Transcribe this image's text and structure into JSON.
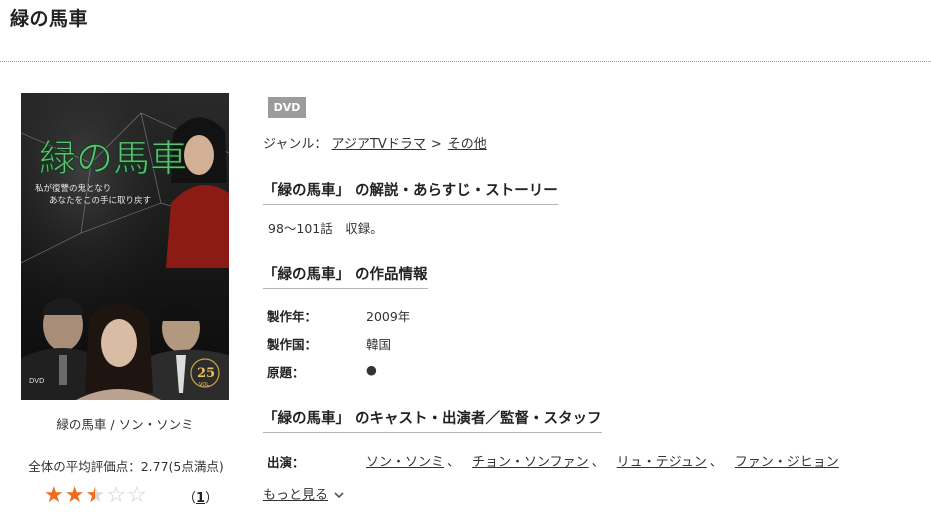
{
  "page": {
    "title": "緑の馬車"
  },
  "cover": {
    "title_art": "緑の馬車",
    "tagline_line1": "私が復讐の鬼となり",
    "tagline_line2": "あなたをこの手に取り戻す",
    "volume_number": "25",
    "volume_label": "VOL.",
    "format_label": "DVD",
    "caption": "緑の馬車 / ソン・ソンミ"
  },
  "rating": {
    "average_text": "全体の平均評価点：2.77(5点満点)",
    "score": 2.77,
    "max": 5,
    "stars": [
      "full",
      "full",
      "half",
      "empty",
      "empty"
    ],
    "star_full_color": "#f26a1b",
    "star_empty_color": "#cfcfcf",
    "count_open": "（",
    "count": "1",
    "count_close": "）"
  },
  "badge": {
    "label": "DVD",
    "color": "#9b9b9b"
  },
  "genre": {
    "label": "ジャンル：",
    "items": [
      "アジアTVドラマ",
      "その他"
    ],
    "separator": ">"
  },
  "sections": {
    "story_heading": "「緑の馬車」 の解説・あらすじ・ストーリー",
    "story_text": "98～101話　収録。",
    "info_heading": "「緑の馬車」 の作品情報",
    "cast_heading": "「緑の馬車」 のキャスト・出演者／監督・スタッフ"
  },
  "info": {
    "year_label": "製作年：",
    "year_value": "2009年",
    "country_label": "製作国：",
    "country_value": "韓国",
    "original_label": "原題：",
    "original_value": "●"
  },
  "cast": {
    "label": "出演：",
    "members": [
      "ソン・ソンミ",
      "チョン・ソンファン",
      "リュ・テジュン",
      "ファン・ジヒョン"
    ],
    "comma": "、",
    "more_label": "もっと見る",
    "more_icon": "chevron-down-icon"
  }
}
